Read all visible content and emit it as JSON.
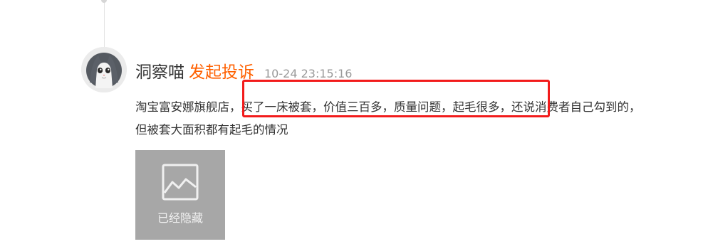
{
  "post": {
    "username": "洞察喵",
    "action": "发起投诉",
    "timestamp": "10-24 23:15:16",
    "content": "淘宝富安娜旗舰店，买了一床被套，价值三百多，质量问题，起毛很多，还说消费者自己勾到的，但被套大面积都有起毛的情况",
    "attachment": {
      "label": "已经隐藏",
      "icon": "image-icon"
    }
  },
  "colors": {
    "action": "#ff6000",
    "highlight_border": "#f21b1b",
    "timestamp": "#999999",
    "hidden_image_bg": "#a7a7a7"
  }
}
